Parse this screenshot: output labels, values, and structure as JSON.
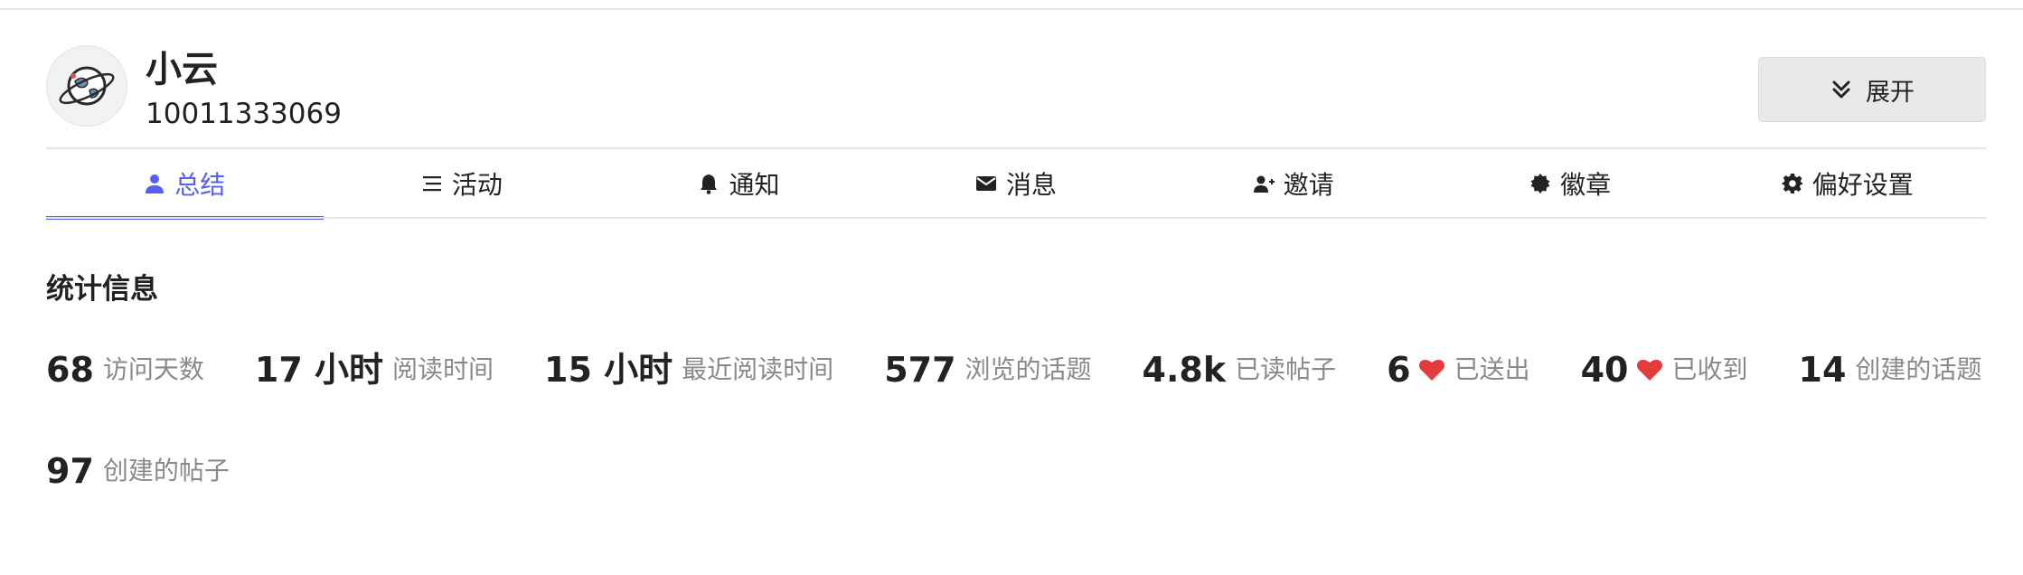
{
  "profile": {
    "name": "小云",
    "id": "10011333069",
    "expand_label": "展开"
  },
  "tabs": [
    {
      "label": "总结",
      "icon": "user-icon",
      "active": true
    },
    {
      "label": "活动",
      "icon": "list-icon",
      "active": false
    },
    {
      "label": "通知",
      "icon": "bell-icon",
      "active": false
    },
    {
      "label": "消息",
      "icon": "envelope-icon",
      "active": false
    },
    {
      "label": "邀请",
      "icon": "user-plus-icon",
      "active": false
    },
    {
      "label": "徽章",
      "icon": "badge-icon",
      "active": false
    },
    {
      "label": "偏好设置",
      "icon": "gear-icon",
      "active": false
    }
  ],
  "stats_title": "统计信息",
  "stats": [
    {
      "value": "68",
      "label": "访问天数"
    },
    {
      "value": "17 小时",
      "label": "阅读时间"
    },
    {
      "value": "15 小时",
      "label": "最近阅读时间"
    },
    {
      "value": "577",
      "label": "浏览的话题"
    },
    {
      "value": "4.8k",
      "label": "已读帖子"
    },
    {
      "value": "6",
      "label": "已送出",
      "icon": "heart-icon"
    },
    {
      "value": "40",
      "label": "已收到",
      "icon": "heart-icon"
    },
    {
      "value": "14",
      "label": "创建的话题"
    },
    {
      "value": "97",
      "label": "创建的帖子"
    }
  ],
  "colors": {
    "accent": "#5660f0",
    "heart": "#e23c3c",
    "muted_text": "#8a8a8a"
  }
}
